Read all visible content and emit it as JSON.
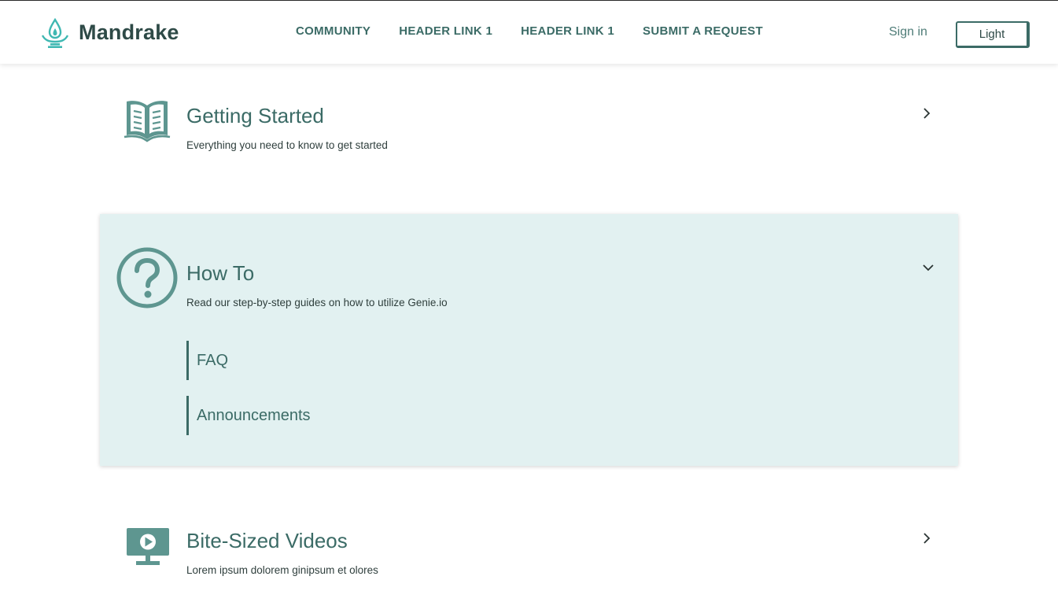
{
  "header": {
    "brand_name": "Mandrake",
    "nav": [
      "COMMUNITY",
      "HEADER LINK 1",
      "HEADER LINK 1",
      "SUBMIT A REQUEST"
    ],
    "sign_in": "Sign in",
    "theme_button": "Light"
  },
  "categories": [
    {
      "title": "Getting Started",
      "description": "Everything you need to know to get started",
      "icon": "open-book-icon",
      "expanded": false
    },
    {
      "title": "How To",
      "description": "Read our step-by-step guides on how to utilize Genie.io",
      "icon": "question-circle-icon",
      "expanded": true,
      "links": [
        "FAQ",
        "Announcements"
      ]
    },
    {
      "title": "Bite-Sized Videos",
      "description": "Lorem ipsum dolorem ginipsum et olores",
      "icon": "video-monitor-icon",
      "expanded": false
    }
  ],
  "colors": {
    "accent": "#3b6b66",
    "logo": "#3fb8b2",
    "active_card_bg": "#e2f1f1",
    "brand_text": "#2e4a47"
  }
}
